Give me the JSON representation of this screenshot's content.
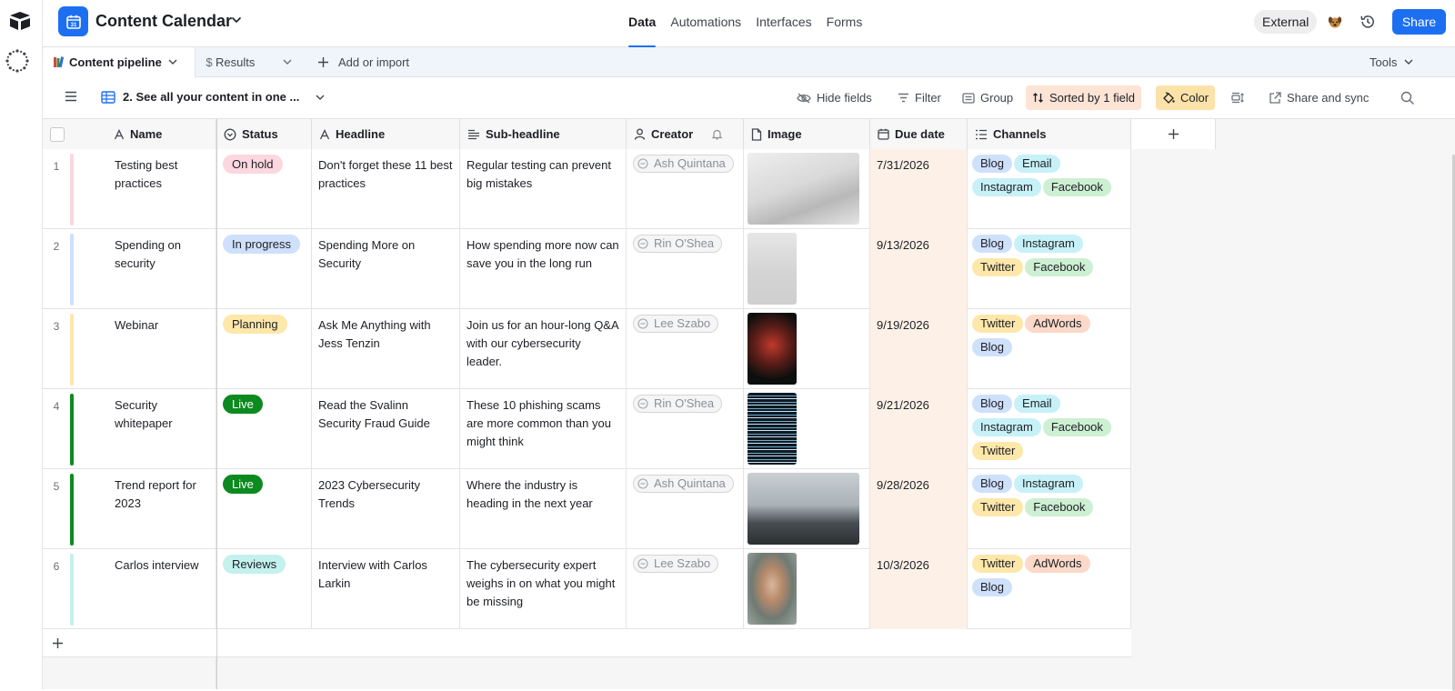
{
  "app": {
    "base_title": "Content Calendar",
    "nav_tabs": [
      "Data",
      "Automations",
      "Interfaces",
      "Forms"
    ],
    "external_label": "External",
    "share_label": "Share"
  },
  "tables": {
    "active_tab": "Content pipeline",
    "second_tab": "Results",
    "add_import": "Add or import",
    "tools": "Tools"
  },
  "view": {
    "name": "2. See all your content in one ...",
    "hide_fields": "Hide fields",
    "filter": "Filter",
    "group": "Group",
    "sorted": "Sorted by 1 field",
    "color": "Color",
    "share_sync": "Share and sync"
  },
  "columns": {
    "name": "Name",
    "status": "Status",
    "headline": "Headline",
    "subheadline": "Sub-headline",
    "creator": "Creator",
    "image": "Image",
    "due": "Due date",
    "channels": "Channels"
  },
  "colors": {
    "accent": "#1d6ff2",
    "onhold": "#fcd7e0",
    "inprogress": "#cfe0fb",
    "planning": "#fde7a9",
    "live": "#0c8a1f",
    "reviews": "#c4f1ee",
    "blog": "#cfe0fb",
    "email": "#c7f1f7",
    "instagram": "#c7f1f7",
    "facebook": "#cdefd2",
    "twitter": "#fde7a9",
    "adwords": "#fcd9c8"
  },
  "rows": [
    {
      "num": "1",
      "name": "Testing best practices",
      "status": "On hold",
      "headline": "Don't forget these 11 best practices",
      "sub": "Regular testing can prevent big mistakes",
      "creator": "Ash Quintana",
      "due": "7/31/2026",
      "channels": [
        "Blog",
        "Email",
        "Instagram",
        "Facebook"
      ]
    },
    {
      "num": "2",
      "name": "Spending on security",
      "status": "In progress",
      "headline": "Spending More on Security",
      "sub": "How spending more now can save you in the long run",
      "creator": "Rin O'Shea",
      "due": "9/13/2026",
      "channels": [
        "Blog",
        "Instagram",
        "Twitter",
        "Facebook"
      ]
    },
    {
      "num": "3",
      "name": "Webinar",
      "status": "Planning",
      "headline": "Ask Me Anything with Jess Tenzin",
      "sub": "Join us for an hour-long Q&A with our cybersecurity leader.",
      "creator": "Lee Szabo",
      "due": "9/19/2026",
      "channels": [
        "Twitter",
        "AdWords",
        "Blog"
      ]
    },
    {
      "num": "4",
      "name": "Security whitepaper",
      "status": "Live",
      "headline": "Read the Svalinn Security Fraud Guide",
      "sub": "These 10 phishing scams are more common than you might think",
      "creator": "Rin O'Shea",
      "due": "9/21/2026",
      "channels": [
        "Blog",
        "Email",
        "Instagram",
        "Facebook",
        "Twitter"
      ]
    },
    {
      "num": "5",
      "name": "Trend report for 2023",
      "status": "Live",
      "headline": "2023 Cybersecurity Trends",
      "sub": "Where the industry is heading in the next year",
      "creator": "Ash Quintana",
      "due": "9/28/2026",
      "channels": [
        "Blog",
        "Instagram",
        "Twitter",
        "Facebook"
      ]
    },
    {
      "num": "6",
      "name": "Carlos interview",
      "status": "Reviews",
      "headline": "Interview with Carlos Larkin",
      "sub": "The cybersecurity expert weighs in on what you might be missing",
      "creator": "Lee Szabo",
      "due": "10/3/2026",
      "channels": [
        "Twitter",
        "AdWords",
        "Blog"
      ]
    }
  ]
}
